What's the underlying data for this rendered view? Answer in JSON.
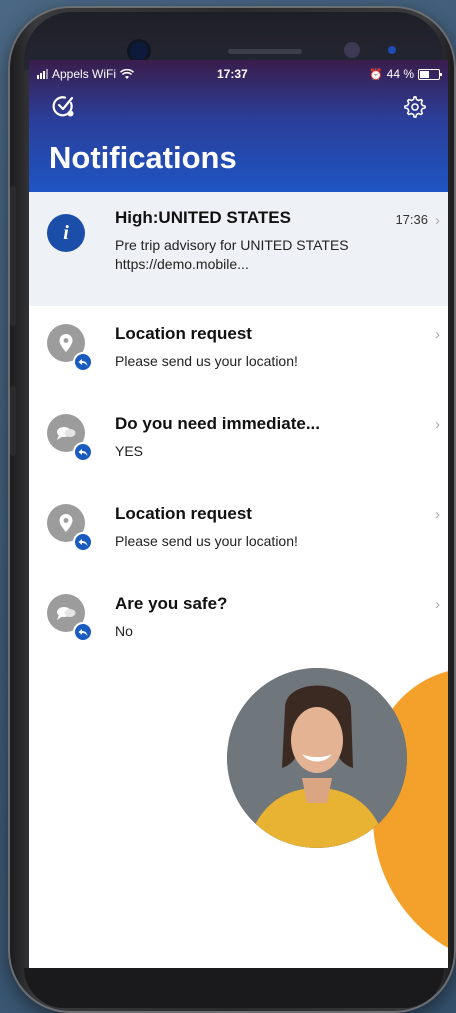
{
  "status_bar": {
    "carrier": "Appels WiFi",
    "time": "17:37",
    "battery": "44 %"
  },
  "header": {
    "title": "Notifications",
    "left_icon": "check-icon",
    "right_icon": "gear-icon"
  },
  "notifications": [
    {
      "title": "High:UNITED STATES",
      "body": "Pre trip advisory for UNITED STATES https://demo.mobile...",
      "time": "17:36",
      "icon": "info-icon"
    },
    {
      "title": "Location request",
      "body": "Please send us your location!",
      "icon": "location-pin-icon"
    },
    {
      "title": "Do you need immediate...",
      "body": "YES",
      "icon": "chat-bubbles-icon"
    },
    {
      "title": "Location request",
      "body": "Please send us your location!",
      "icon": "location-pin-icon"
    },
    {
      "title": "Are you safe?",
      "body": "No",
      "icon": "chat-bubbles-icon"
    }
  ],
  "colors": {
    "header_top": "#3a1d4c",
    "header_bottom": "#1e55c4",
    "accent_blue": "#1a4ea8",
    "orange": "#f3a12b"
  }
}
